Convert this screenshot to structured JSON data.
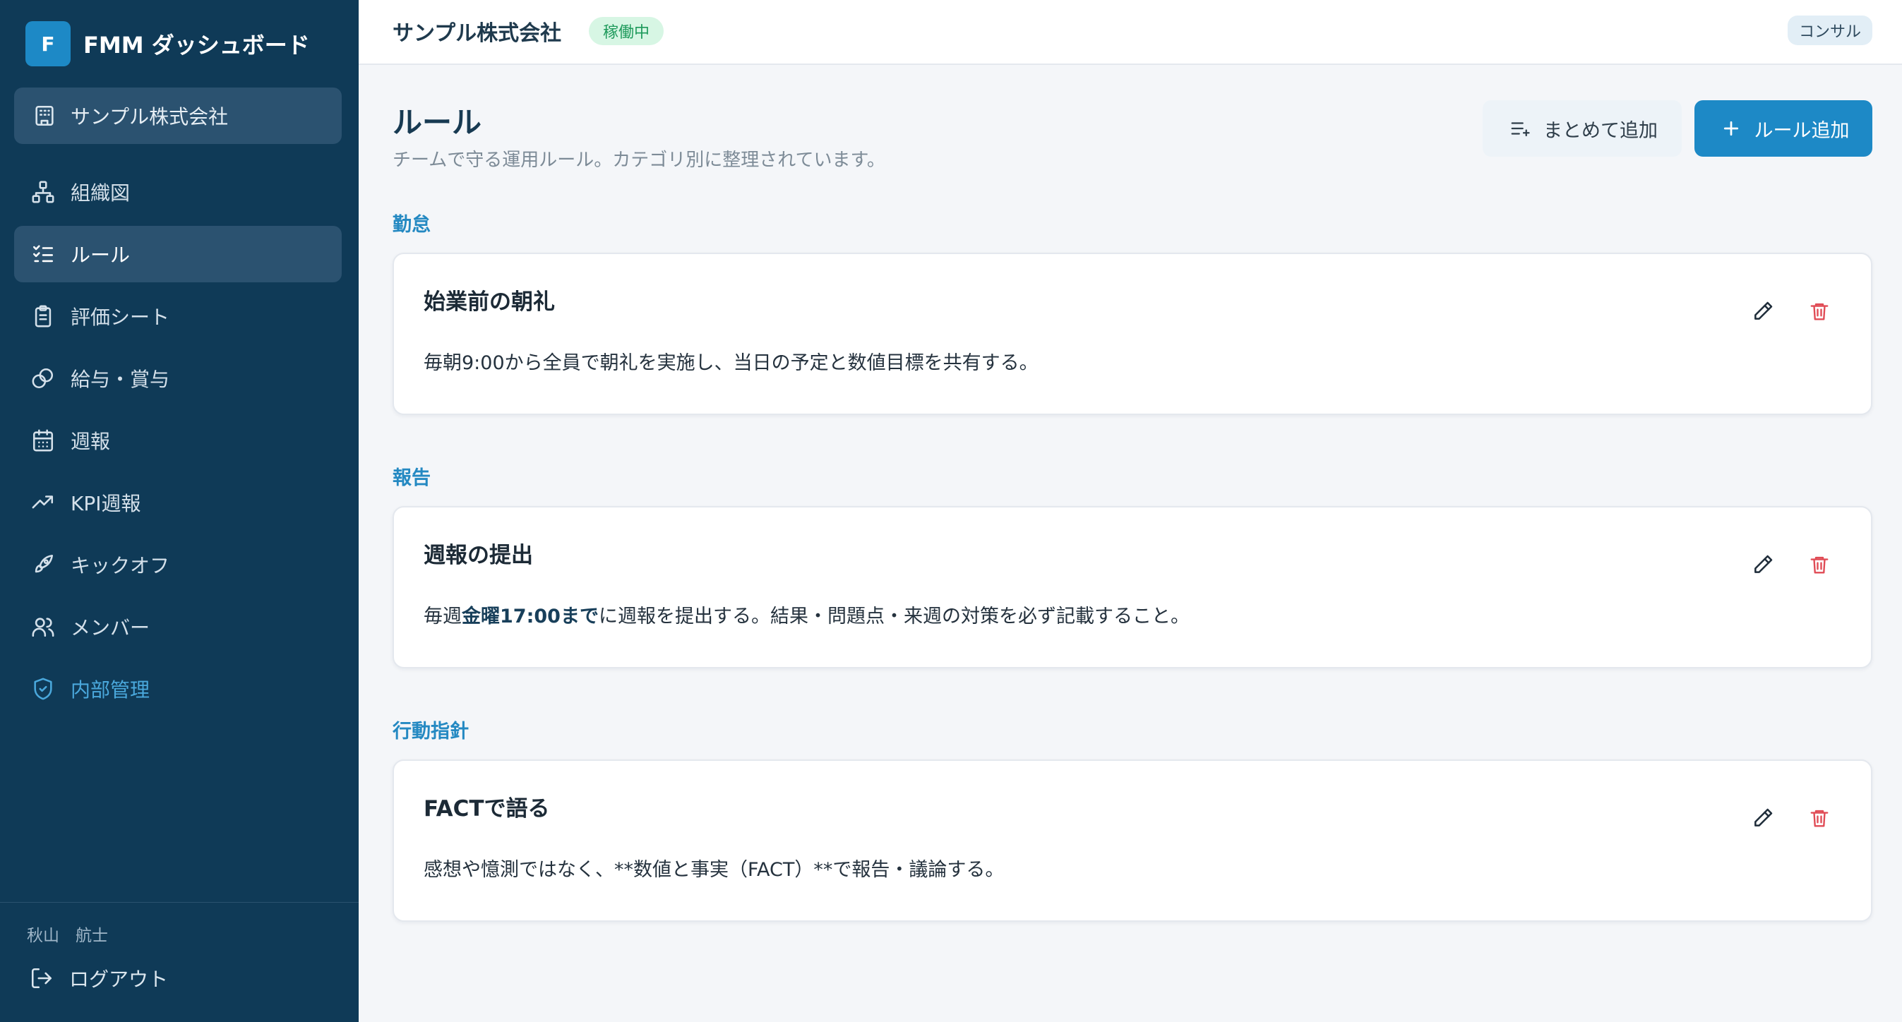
{
  "sidebar": {
    "brand_letter": "F",
    "brand_name": "FMM ダッシュボード",
    "company": "サンプル株式会社",
    "items": [
      {
        "label": "組織図",
        "icon": "org-chart-icon"
      },
      {
        "label": "ルール",
        "icon": "checklist-icon",
        "active": true
      },
      {
        "label": "評価シート",
        "icon": "clipboard-icon"
      },
      {
        "label": "給与・賞与",
        "icon": "coins-icon"
      },
      {
        "label": "週報",
        "icon": "calendar-icon"
      },
      {
        "label": "KPI週報",
        "icon": "trending-up-icon"
      },
      {
        "label": "キックオフ",
        "icon": "rocket-icon"
      },
      {
        "label": "メンバー",
        "icon": "users-icon"
      }
    ],
    "internal": {
      "label": "内部管理",
      "icon": "shield-check-icon"
    },
    "user_name": "秋山　航士",
    "logout_label": "ログアウト"
  },
  "header": {
    "company": "サンプル株式会社",
    "status": "稼働中",
    "role": "コンサル"
  },
  "main": {
    "title": "ルール",
    "subtitle": "チームで守る運用ルール。カテゴリ別に整理されています。",
    "bulk_add_label": "まとめて追加",
    "add_rule_label": "ルール追加",
    "categories": [
      {
        "name": "勤怠",
        "rules": [
          {
            "title": "始業前の朝礼",
            "body": "毎朝9:00から全員で朝礼を実施し、当日の予定と数値目標を共有する。"
          }
        ]
      },
      {
        "name": "報告",
        "rules": [
          {
            "title": "週報の提出",
            "body_pre": "毎週",
            "body_bold": "金曜17:00まで",
            "body_post": "に週報を提出する。結果・問題点・来週の対策を必ず記載すること。"
          }
        ]
      },
      {
        "name": "行動指針",
        "rules": [
          {
            "title": "FACTで語る",
            "body": "感想や憶測ではなく、**数値と事実（FACT）**で報告・議論する。"
          }
        ]
      }
    ]
  },
  "colors": {
    "sidebar_bg": "#0f3a57",
    "accent": "#1d89c6",
    "danger": "#e04b55",
    "status_green": "#1e9a5b"
  }
}
